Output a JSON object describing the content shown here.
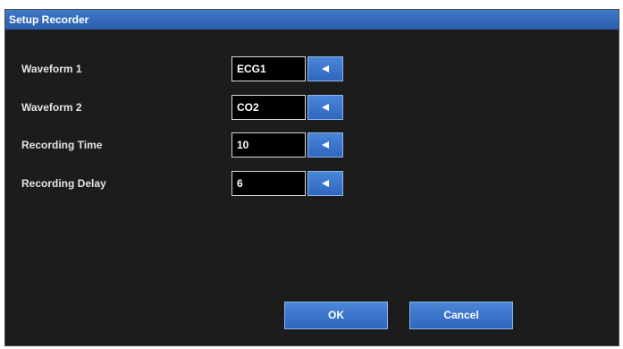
{
  "window": {
    "title": "Setup Recorder"
  },
  "settings": [
    {
      "label": "Waveform 1",
      "value": "ECG1"
    },
    {
      "label": "Waveform 2",
      "value": "CO2"
    },
    {
      "label": "Recording Time",
      "value": "10"
    },
    {
      "label": "Recording Delay",
      "value": "6"
    }
  ],
  "buttons": {
    "ok_label": "OK",
    "cancel_label": "Cancel"
  },
  "icons": {
    "selector": "triangle-left-icon"
  },
  "colors": {
    "title_bar": "#3f78c8",
    "panel_background": "#1c1c1c",
    "button_blue": "#3b74cc",
    "value_background": "#000000"
  }
}
